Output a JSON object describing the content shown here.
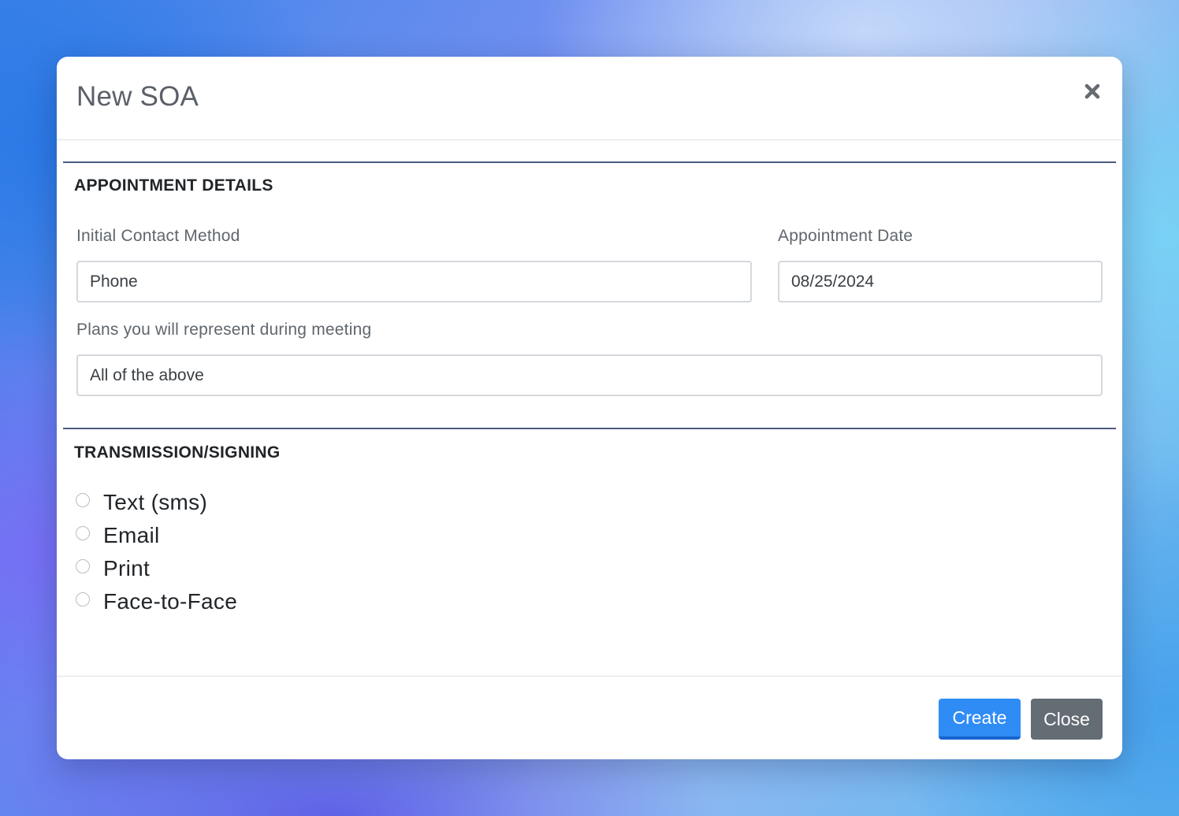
{
  "modal": {
    "title": "New SOA",
    "close_icon": "close-x-icon"
  },
  "appointment_details": {
    "heading": "APPOINTMENT DETAILS",
    "initial_contact_method": {
      "label": "Initial Contact Method",
      "value": "Phone"
    },
    "appointment_date": {
      "label": "Appointment Date",
      "value": "08/25/2024"
    },
    "plans": {
      "label": "Plans you will represent during meeting",
      "value": "All of the above"
    }
  },
  "transmission": {
    "heading": "TRANSMISSION/SIGNING",
    "options": [
      {
        "label": "Text (sms)",
        "selected": false
      },
      {
        "label": "Email",
        "selected": false
      },
      {
        "label": "Print",
        "selected": false
      },
      {
        "label": "Face-to-Face",
        "selected": false
      }
    ]
  },
  "footer": {
    "create_label": "Create",
    "close_label": "Close"
  },
  "colors": {
    "primary": "#2f8cf5",
    "secondary": "#646c74",
    "section_rule": "#4a5a7c"
  }
}
